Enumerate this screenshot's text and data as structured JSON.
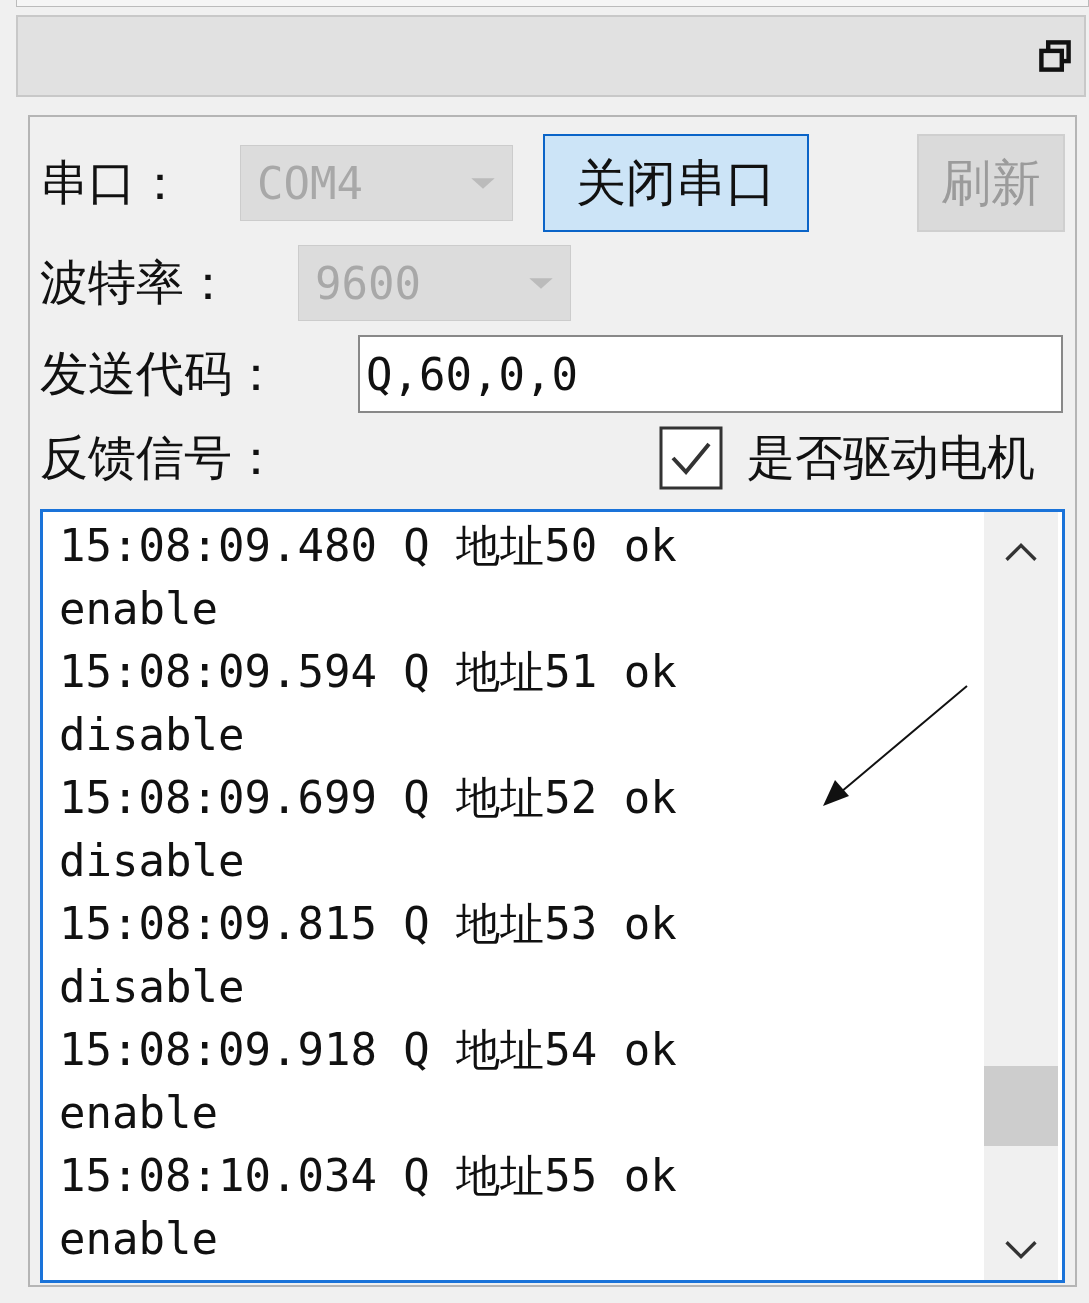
{
  "port": {
    "label": "串口：",
    "value": "COM4",
    "disabled": true
  },
  "close_button": {
    "label": "关闭串口",
    "focused": true
  },
  "refresh_button": {
    "label": "刷新",
    "disabled": true
  },
  "baud": {
    "label": "波特率：",
    "value": "9600",
    "disabled": true
  },
  "send": {
    "label": "发送代码：",
    "value": "Q,60,0,0"
  },
  "feedback": {
    "label": "反馈信号："
  },
  "drive_motor": {
    "label": "是否驱动电机",
    "checked": true
  },
  "log": [
    {
      "line": "15:08:09.480 Q 地址50 ok",
      "status": "enable"
    },
    {
      "line": "15:08:09.594 Q 地址51 ok",
      "status": "disable"
    },
    {
      "line": "15:08:09.699 Q 地址52 ok",
      "status": "disable"
    },
    {
      "line": "15:08:09.815 Q 地址53 ok",
      "status": "disable"
    },
    {
      "line": "15:08:09.918 Q 地址54 ok",
      "status": "enable"
    },
    {
      "line": "15:08:10.034 Q 地址55 ok",
      "status": "enable"
    }
  ]
}
